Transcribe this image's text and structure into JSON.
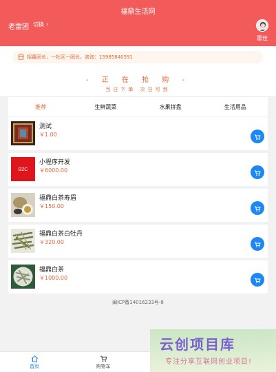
{
  "header": {
    "app_title": "福鼎生活网",
    "leader_name": "老雷团",
    "switch_label": "切换",
    "avatar_name": "雷佳"
  },
  "notice": {
    "text": "招募团长，一社区一团长，咨询：15985840591"
  },
  "rush": {
    "title": "- 正 在 抢 购 -",
    "subtitle": "当日下单 次日可到"
  },
  "tabs": [
    {
      "label": "推荐",
      "active": true
    },
    {
      "label": "生鲜蔬菜",
      "active": false
    },
    {
      "label": "水果拼盘",
      "active": false
    },
    {
      "label": "生活用品",
      "active": false
    }
  ],
  "products": [
    {
      "name": "测试",
      "price": "￥1.00",
      "thumb": "frame-image"
    },
    {
      "name": "小程序开发",
      "price": "￥6000.00",
      "thumb": "b2c-image",
      "thumb_text": "B2C"
    },
    {
      "name": "福鼎白茶寿眉",
      "price": "￥150.00",
      "thumb": "tea-cup-image"
    },
    {
      "name": "福鼎白茶白牡丹",
      "price": "￥320.00",
      "thumb": "tea-leaves-image"
    },
    {
      "name": "福鼎白茶",
      "price": "￥1000.00",
      "thumb": "tea-bowl-image"
    }
  ],
  "icp": "闽ICP备14016233号-8",
  "tabbar": [
    {
      "label": "首页",
      "icon": "home-icon",
      "active": true
    },
    {
      "label": "购物车",
      "icon": "cart-icon",
      "active": false
    }
  ],
  "watermark": {
    "main": "云创项目库",
    "sub": "专注分享互联网创业项目!"
  },
  "colors": {
    "header_bg": "#f35b5b",
    "accent_orange": "#e0673a",
    "cart_blue": "#1e88f2"
  }
}
